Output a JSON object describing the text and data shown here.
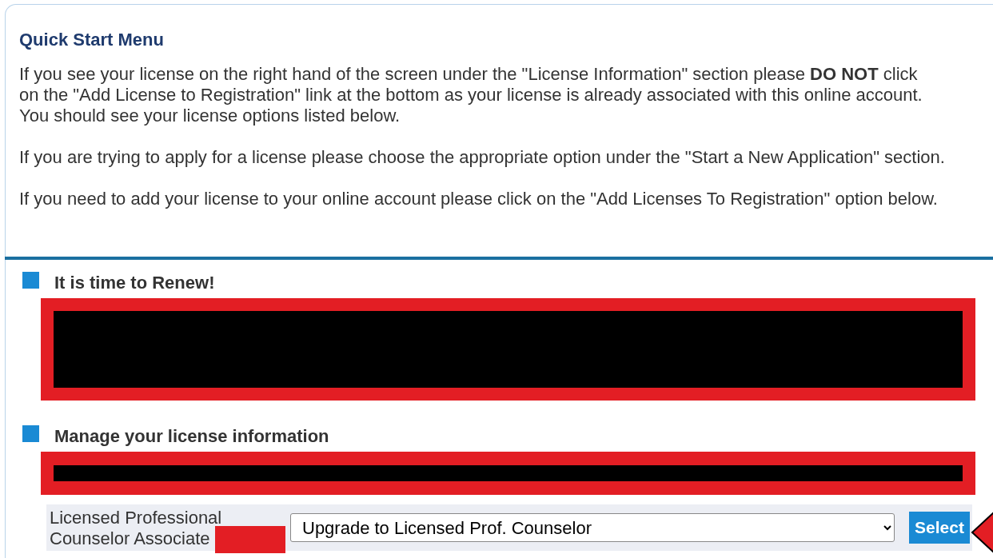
{
  "panel": {
    "title": "Quick Start Menu",
    "paragraphs": [
      "If you see your license on the right hand of the screen under the \"License Information\" section please **DO NOT** click\non the \"Add License to Registration\" link at the bottom as your license is already associated with this online account.\nYou should see your license options listed below.",
      "If you are trying to apply for a license please choose the appropriate option under the \"Start a New Application\" section.",
      "If you need to add your license to your online account please click on the \"Add Licenses To Registration\" option below."
    ]
  },
  "sections": [
    {
      "title": "It is time to Renew!",
      "kind": "tall"
    },
    {
      "title": "Manage your license information",
      "kind": "short"
    }
  ],
  "license_row": {
    "label": "Licensed Professional\nCounselor Associate",
    "redacted": true,
    "action": {
      "value": "Upgrade to Licensed Prof. Counselor"
    },
    "button": "Select",
    "pointer_arrow": true
  }
}
